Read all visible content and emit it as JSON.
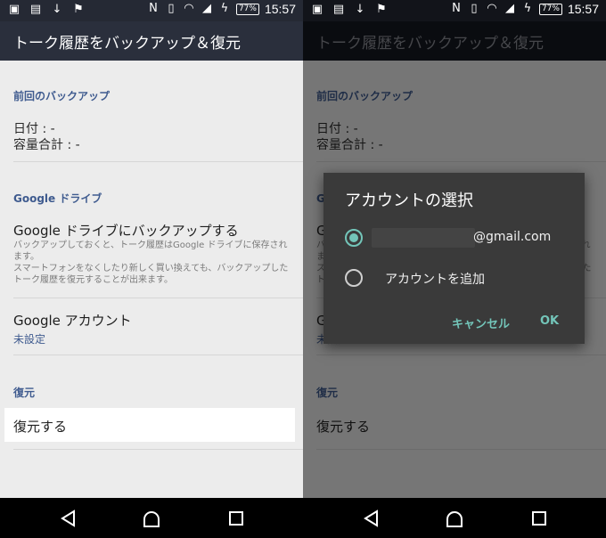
{
  "status_bar": {
    "time": "15:57",
    "battery": "77%",
    "icons_left": [
      "image-icon",
      "sim-icon",
      "download-icon",
      "flag-icon"
    ],
    "icons_right": [
      "nfc-icon",
      "vibrate-icon",
      "wifi-icon",
      "signal-icon",
      "charging-icon"
    ]
  },
  "app_bar": {
    "title": "トーク履歴をバックアップ＆復元"
  },
  "sections": {
    "previous_backup": {
      "header": "前回のバックアップ",
      "date_line": "日付 : -",
      "size_line": "容量合計 : -"
    },
    "google_drive": {
      "header": "Google ドライブ",
      "backup_title": "Google ドライブにバックアップする",
      "backup_desc_1": "バックアップしておくと、トーク履歴はGoogle ドライブに保存されます。",
      "backup_desc_2": "スマートフォンをなくしたり新しく買い換えても、バックアップしたトーク履歴を復元することが出来ます。",
      "account_title": "Google アカウント",
      "account_value": "未設定"
    },
    "restore": {
      "header": "復元",
      "restore_button": "復元する"
    }
  },
  "dialog": {
    "title": "アカウントの選択",
    "option_email": "@gmail.com",
    "option_add": "アカウントを追加",
    "cancel": "キャンセル",
    "ok": "OK"
  },
  "colors": {
    "status_bar": "#252934",
    "app_bar": "#2a2f3c",
    "section_header": "#3f5b8f",
    "dialog_accent": "#73c5b9",
    "dialog_bg": "#3a3a3a"
  }
}
